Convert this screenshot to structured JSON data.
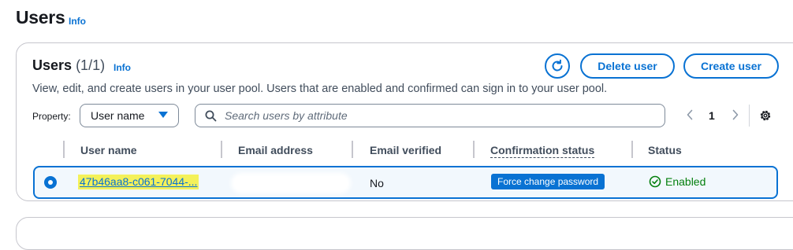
{
  "page": {
    "title": "Users",
    "info": "Info"
  },
  "panel": {
    "title": "Users",
    "count": "(1/1)",
    "info": "Info",
    "description": "View, edit, and create users in your user pool. Users that are enabled and confirmed can sign in to your user pool.",
    "delete_label": "Delete user",
    "create_label": "Create user",
    "refresh_icon": "refresh-icon"
  },
  "filter": {
    "property_label": "Property:",
    "property_value": "User name",
    "search_placeholder": "Search users by attribute"
  },
  "pagination": {
    "current_page": "1"
  },
  "table": {
    "columns": [
      "User name",
      "Email address",
      "Email verified",
      "Confirmation status",
      "Status"
    ],
    "rows": [
      {
        "selected": true,
        "username": "47b46aa8-c061-7044-...",
        "email": "",
        "email_verified": "No",
        "confirmation_status": "Force change password",
        "status": "Enabled"
      }
    ]
  },
  "colors": {
    "accent": "#0972d3",
    "success": "#037f0c",
    "highlight": "#f4f15a",
    "selected_row_bg": "#f2f8fd"
  }
}
